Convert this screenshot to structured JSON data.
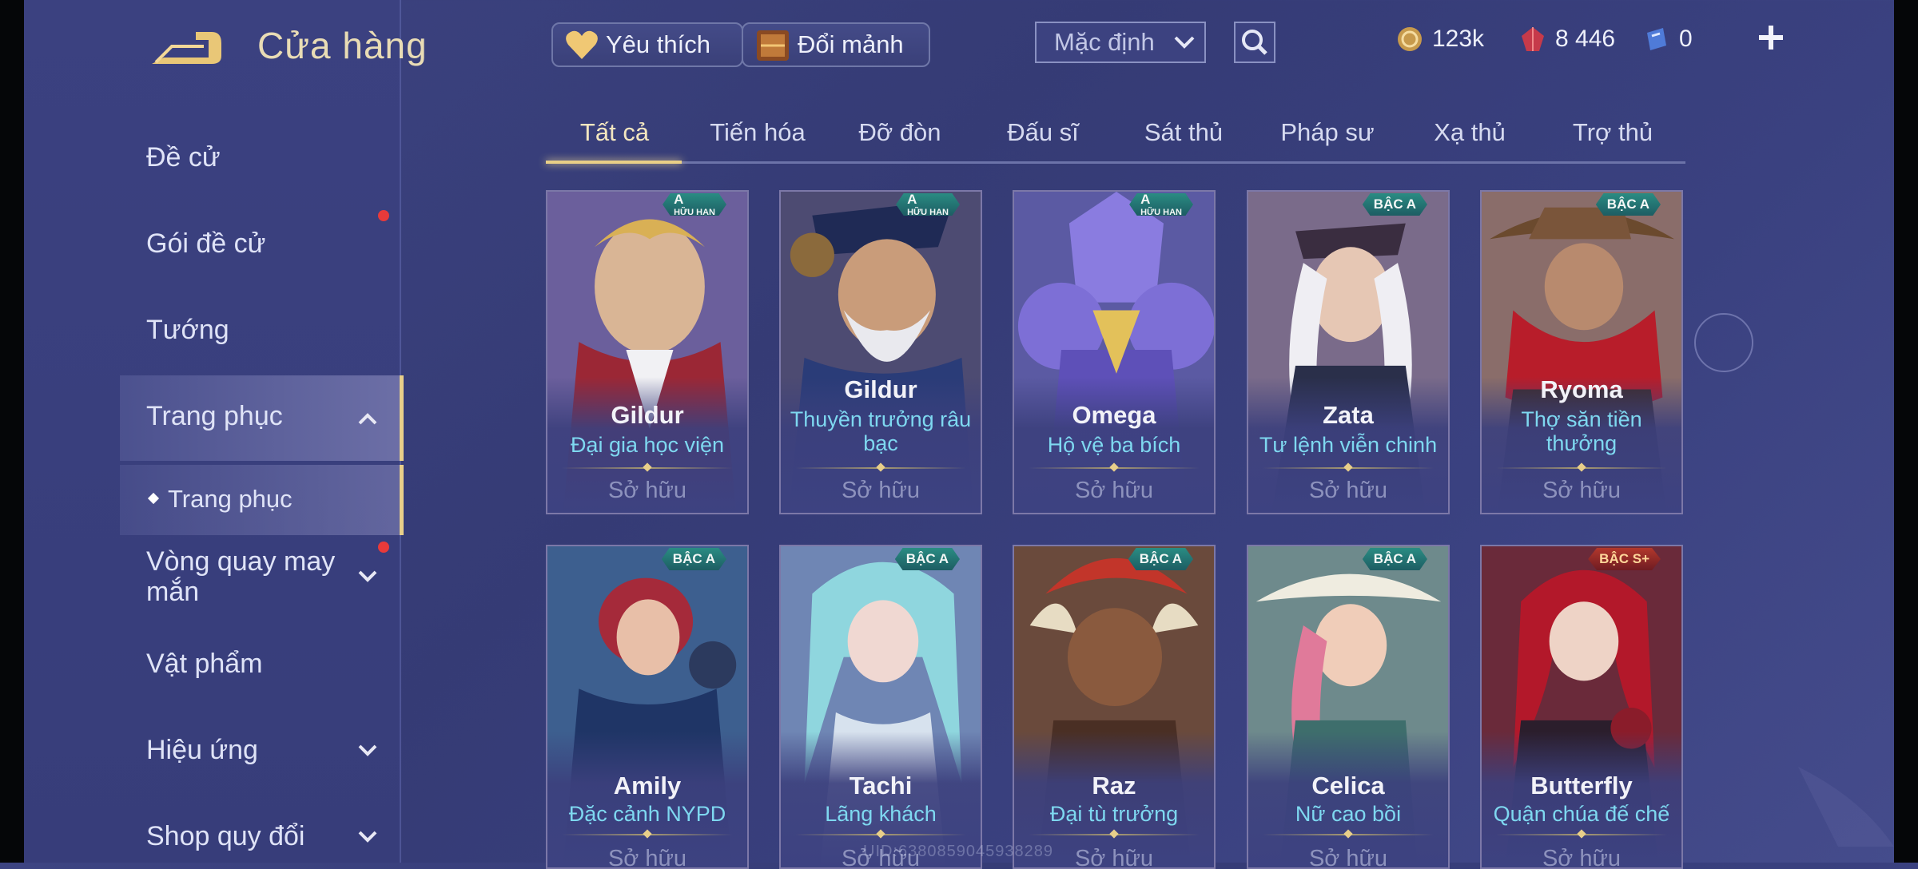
{
  "header": {
    "title": "Cửa hàng",
    "favorites_label": "Yêu thích",
    "exchange_label": "Đổi mảnh",
    "sort_value": "Mặc định",
    "currencies": [
      {
        "icon": "gold-coin-icon",
        "value": "123k"
      },
      {
        "icon": "red-gem-icon",
        "value": "8 446"
      },
      {
        "icon": "blue-voucher-icon",
        "value": "0"
      }
    ]
  },
  "sidebar": {
    "items": [
      {
        "label": "Đề cử"
      },
      {
        "label": "Gói đề cử"
      },
      {
        "label": "Tướng"
      },
      {
        "label": "Trang phục"
      },
      {
        "label": "Trang phục"
      },
      {
        "label": "Vòng quay may mắn"
      },
      {
        "label": "Vật phẩm"
      },
      {
        "label": "Hiệu ứng"
      },
      {
        "label": "Shop quy đổi"
      }
    ]
  },
  "tabs": [
    "Tất cả",
    "Tiến hóa",
    "Đỡ đòn",
    "Đấu sĩ",
    "Sát thủ",
    "Pháp sư",
    "Xạ thủ",
    "Trợ thủ"
  ],
  "cards": [
    {
      "hero": "Gildur",
      "skin": "Đại gia học viện",
      "badge": "A",
      "badge_sub": "HỮU HẠN",
      "status": "Sở hữu"
    },
    {
      "hero": "Gildur",
      "skin": "Thuyền trưởng râu bạc",
      "badge": "A",
      "badge_sub": "HỮU HẠN",
      "status": "Sở hữu"
    },
    {
      "hero": "Omega",
      "skin": "Hộ vệ ba bích",
      "badge": "A",
      "badge_sub": "HỮU HẠN",
      "status": "Sở hữu"
    },
    {
      "hero": "Zata",
      "skin": "Tư lệnh viễn chinh",
      "badge": "BẬC A",
      "status": "Sở hữu"
    },
    {
      "hero": "Ryoma",
      "skin": "Thợ săn tiền thưởng",
      "badge": "BẬC A",
      "status": "Sở hữu"
    },
    {
      "hero": "Amily",
      "skin": "Đặc cảnh NYPD",
      "badge": "BẬC A",
      "status": "Sở hữu"
    },
    {
      "hero": "Tachi",
      "skin": "Lãng khách",
      "badge": "BẬC A",
      "status": "Sở hữu"
    },
    {
      "hero": "Raz",
      "skin": "Đại tù trưởng",
      "badge": "BẬC A",
      "status": "Sở hữu"
    },
    {
      "hero": "Celica",
      "skin": "Nữ cao bồi",
      "badge": "BẬC A",
      "status": "Sở hữu"
    },
    {
      "hero": "Butterfly",
      "skin": "Quận chúa đế chế",
      "badge": "BẬC S+",
      "status": "Sở hữu"
    }
  ],
  "watermark": "UID:6380859045938289"
}
